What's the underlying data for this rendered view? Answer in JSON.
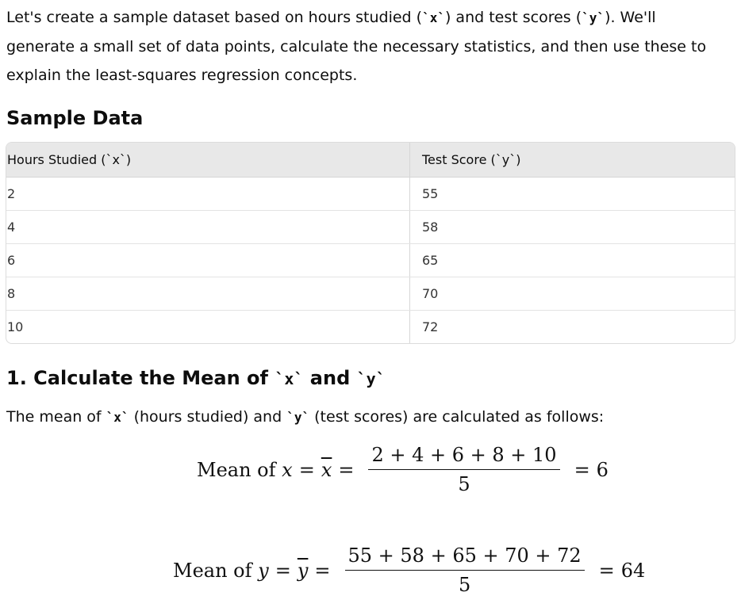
{
  "intro": {
    "p1": "Let's create a sample dataset based on hours studied (",
    "x_code": "`x`",
    "p2": ") and test scores (",
    "y_code": "`y`",
    "p3": "). We'll generate a small set of data points, calculate the necessary statistics, and then use these to explain the least-squares regression concepts."
  },
  "sample_heading": "Sample Data",
  "table": {
    "headers": [
      "Hours Studied (`x`)",
      "Test Score (`y`)"
    ],
    "rows": [
      [
        "2",
        "55"
      ],
      [
        "4",
        "58"
      ],
      [
        "6",
        "65"
      ],
      [
        "8",
        "70"
      ],
      [
        "10",
        "72"
      ]
    ]
  },
  "mean_heading": {
    "prefix": "1. Calculate the Mean of ",
    "x_code": "`x`",
    "middle": " and ",
    "y_code": "`y`"
  },
  "mean_para": {
    "p1": "The mean of ",
    "x_code": "`x`",
    "p2": " (hours studied) and ",
    "y_code": "`y`",
    "p3": " (test scores) are calculated as follows:"
  },
  "eq_x": {
    "label": "Mean of ",
    "var": "x",
    "eq": "=",
    "bar_var": "x",
    "eq2": "=",
    "numerator": "2 + 4 + 6 + 8 + 10",
    "denominator": "5",
    "eq3": "=",
    "result": "6"
  },
  "eq_y": {
    "label": "Mean of ",
    "var": "y",
    "eq": "=",
    "bar_var": "y",
    "eq2": "=",
    "numerator": "55 + 58 + 65 + 70 + 72",
    "denominator": "5",
    "eq3": "=",
    "result": "64"
  }
}
